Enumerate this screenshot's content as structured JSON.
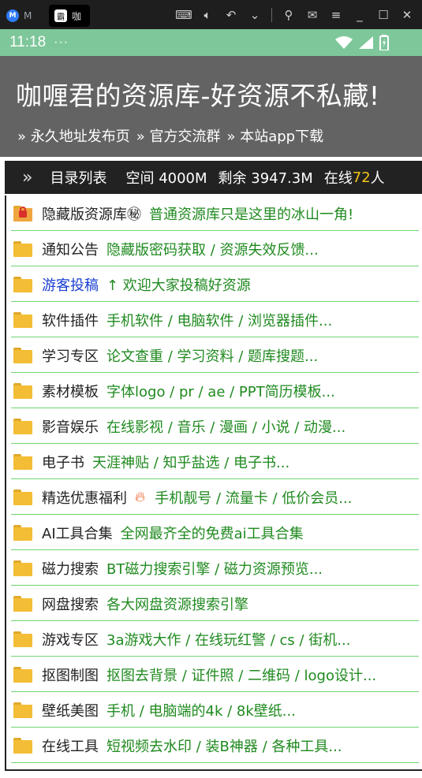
{
  "chrome": {
    "inactive_tab_label": "M",
    "active_tab_label": "咖",
    "active_tab_favicon": "霸",
    "icons": [
      "keyboard-icon",
      "speaker-icon",
      "undo-icon",
      "chevron-down-icon",
      "user-icon",
      "mail-icon",
      "menu-icon",
      "minimize-icon",
      "maximize-icon",
      "close-icon"
    ]
  },
  "status": {
    "time": "11:18",
    "dots": "···"
  },
  "header": {
    "title": "咖喱君的资源库-好资源不私藏!",
    "links": [
      "» 永久地址发布页",
      "» 官方交流群",
      "» 本站app下载"
    ]
  },
  "infobar": {
    "chevron": "»",
    "directory": "目录列表",
    "space": "空间 4000M",
    "remaining": "剩余 3947.3M",
    "online_label": "在线",
    "online_count": "72",
    "online_unit": "人"
  },
  "rows": [
    {
      "name": "隐藏版资源库㊙",
      "desc": "普通资源库只是这里的冰山一角!",
      "icon": "locked-folder-icon"
    },
    {
      "name": "通知公告",
      "desc": "隐藏版密码获取 / 资源失效反馈...",
      "icon": "folder-icon"
    },
    {
      "name": "游客投稿",
      "desc": "↑ 欢迎大家投稿好资源",
      "icon": "folder-icon"
    },
    {
      "name": "软件插件",
      "desc": "手机软件 / 电脑软件 / 浏览器插件...",
      "icon": "folder-icon"
    },
    {
      "name": "学习专区",
      "desc": "论文查重 / 学习资料 / 题库搜题...",
      "icon": "folder-icon"
    },
    {
      "name": "素材模板",
      "desc": "字体logo / pr / ae / PPT简历模板...",
      "icon": "folder-icon"
    },
    {
      "name": "影音娱乐",
      "desc": "在线影视 / 音乐 / 漫画 / 小说 / 动漫...",
      "icon": "folder-icon"
    },
    {
      "name": "电子书",
      "desc": "天涯神贴 / 知乎盐选 / 电子书...",
      "icon": "folder-icon"
    },
    {
      "name": "精选优惠福利",
      "desc": "手机靓号 / 流量卡 / 低价会员...",
      "icon": "folder-icon"
    },
    {
      "name": "AI工具合集",
      "desc": "全网最齐全的免费ai工具合集",
      "icon": "folder-icon"
    },
    {
      "name": "磁力搜索",
      "desc": "BT磁力搜索引擎 / 磁力资源预览...",
      "icon": "folder-icon"
    },
    {
      "name": "网盘搜索",
      "desc": "各大网盘资源搜索引擎",
      "icon": "folder-icon"
    },
    {
      "name": "游戏专区",
      "desc": "3a游戏大作 / 在线玩红警 / cs / 街机...",
      "icon": "folder-icon"
    },
    {
      "name": "抠图制图",
      "desc": "抠图去背景 / 证件照 / 二维码 / logo设计...",
      "icon": "folder-icon"
    },
    {
      "name": "壁纸美图",
      "desc": "手机 / 电脑端的4k / 8k壁纸...",
      "icon": "folder-icon"
    },
    {
      "name": "在线工具",
      "desc": "短视频去水印 / 装B神器 / 各种工具...",
      "icon": "folder-icon"
    }
  ],
  "colors": {
    "status_green": "#7ec79b",
    "header_gray": "#636363",
    "desc_green": "#1f8a1f",
    "link_blue": "#1a3fd1",
    "online_yellow": "#f5c518"
  }
}
